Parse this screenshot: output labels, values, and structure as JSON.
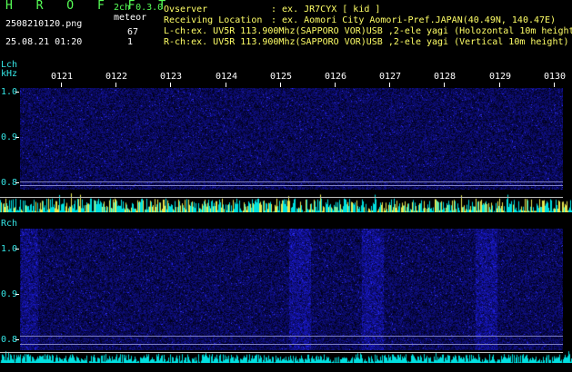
{
  "header": {
    "title": "H R O F F T",
    "mode": "2ch 0.3.0",
    "filename": "2508210120.png",
    "meteor_label": "meteor",
    "lch_count": "67",
    "rch_count": "1",
    "datetime": "25.08.21 01:20"
  },
  "info": {
    "observer_label": "Ovserver",
    "observer_value": ": ex. JR7CYX [ kid ]",
    "location_label": "Receiving Location",
    "location_value": ": ex. Aomori City Aomori-Pref.JAPAN(40.49N, 140.47E)",
    "lch_line": "L-ch:ex. UV5R 113.900Mhz(SAPPORO VOR)USB ,2-ele yagi (Holozontal 10m height)",
    "rch_line": "R-ch:ex. UV5R 113.900Mhz(SAPPORO VOR)USB ,2-ele yagi (Vertical 10m height)"
  },
  "axis": {
    "lch_label": "Lch",
    "khz_label": "kHz",
    "rch_label": "Rch",
    "time_ticks": [
      "0121",
      "0122",
      "0123",
      "0124",
      "0125",
      "0126",
      "0127",
      "0128",
      "0129",
      "0130"
    ],
    "freq_ticks": [
      "1.0",
      "0.9",
      "0.8"
    ]
  },
  "colors": {
    "background": "#000000",
    "label_cyan": "#35e6e6",
    "label_green": "#56ff56",
    "spectrum_noise": "#15157a",
    "waveform_cyan": "#00e0e0",
    "waveform_yellow": "#e8e850"
  }
}
